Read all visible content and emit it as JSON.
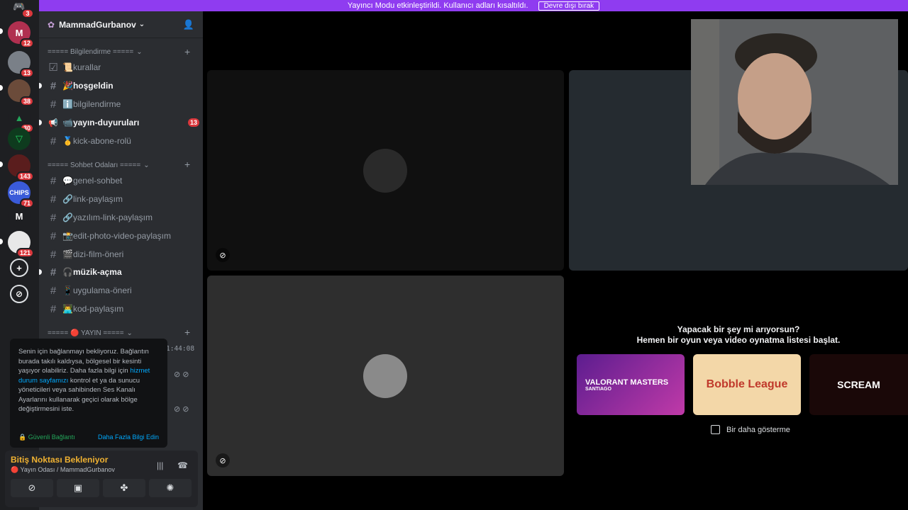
{
  "banner": {
    "text": "Yayıncı Modu etkinleştirildi. Kullanıcı adları kısaltıldı.",
    "button": "Devre dışı bırak"
  },
  "rail": {
    "servers": [
      {
        "name": "discord-home",
        "label": "",
        "badge": "3",
        "color": "#5865f2"
      },
      {
        "name": "server-m-red",
        "label": "M",
        "badge": "12",
        "color": "#b03050"
      },
      {
        "name": "server-2",
        "label": "",
        "badge": "13",
        "color": "#7a8088"
      },
      {
        "name": "server-3",
        "label": "",
        "badge": "38",
        "color": "#6b4b3a"
      },
      {
        "name": "server-4",
        "label": "",
        "badge": "30",
        "color": "#2f7d32"
      },
      {
        "name": "server-5",
        "label": "",
        "badge": "",
        "color": "#0e3b1e"
      },
      {
        "name": "server-6",
        "label": "",
        "badge": "143",
        "color": "#5a1d1d"
      },
      {
        "name": "server-7",
        "label": "",
        "badge": "71",
        "color": "#3a5bd9"
      },
      {
        "name": "server-m",
        "label": "M",
        "badge": "",
        "color": "#1e1f22"
      },
      {
        "name": "server-8",
        "label": "",
        "badge": "121",
        "color": "#e8e8e8"
      }
    ],
    "add_icon": "+",
    "discover_icon": "⊘"
  },
  "sidebar": {
    "server_name": "MammadGurbanov",
    "categories": [
      {
        "label": "===== Bilgilendirme ====="
      },
      {
        "label": "===== Sohbet Odaları ====="
      },
      {
        "label": "===== 🔴 YAYIN ====="
      }
    ],
    "channels": [
      {
        "icon": "☑",
        "label": "📜kurallar",
        "unread": false,
        "count": ""
      },
      {
        "icon": "#",
        "label": "🎉hoşgeldin",
        "unread": true,
        "count": ""
      },
      {
        "icon": "#",
        "label": "ℹ️bilgilendirme",
        "unread": false,
        "count": ""
      },
      {
        "icon": "📢",
        "label": "📹yayın-duyuruları",
        "unread": true,
        "count": "13"
      },
      {
        "icon": "#",
        "label": "🥇kick-abone-rolü",
        "unread": false,
        "count": ""
      },
      {
        "icon": "#",
        "label": "💬genel-sohbet",
        "unread": false,
        "count": ""
      },
      {
        "icon": "#",
        "label": "🔗link-paylaşım",
        "unread": false,
        "count": ""
      },
      {
        "icon": "#",
        "label": "🔗yazılım-link-paylaşım",
        "unread": false,
        "count": ""
      },
      {
        "icon": "#",
        "label": "📸edit-photo-video-paylaşım",
        "unread": false,
        "count": ""
      },
      {
        "icon": "#",
        "label": "🎬dizi-film-öneri",
        "unread": false,
        "count": ""
      },
      {
        "icon": "#",
        "label": "🎧müzik-açma",
        "unread": true,
        "count": ""
      },
      {
        "icon": "#",
        "label": "📱uygulama-öneri",
        "unread": false,
        "count": ""
      },
      {
        "icon": "#",
        "label": "👨‍💻kod-paylaşım",
        "unread": false,
        "count": ""
      }
    ],
    "timer": "1:44:08"
  },
  "popup": {
    "text1": "Senin için bağlanmayı bekliyoruz. Bağlantın burada takılı kaldıysa, bölgesel bir kesinti yaşıyor olabiliriz. Daha fazla bilgi için ",
    "link": "hizmet durum sayfamızı",
    "text2": " kontrol et ya da sunucu yöneticileri veya sahibinden Ses Kanalı Ayarlarını kullanarak geçici olarak bölge değiştirmesini iste.",
    "secure": "🔒 Güvenli Bağlantı",
    "learn_more": "Daha Fazla Bilgi Edin"
  },
  "voice": {
    "status": "Bitiş Noktası Bekleniyor",
    "channel": "🔴 Yayın Odası / MammadGurbanov"
  },
  "suggestion": {
    "line1": "Yapacak bir şey mi arıyorsun?",
    "line2": "Hemen bir oyun veya video oynatma listesi başlat.",
    "cards": [
      {
        "title": "VALORANT MASTERS",
        "subtitle": "SANTIAGO",
        "color": "#8a2bb8"
      },
      {
        "title": "Bobble League",
        "subtitle": "",
        "color": "#f3d7a8"
      },
      {
        "title": "SCREAM",
        "subtitle": "",
        "color": "#1a0808"
      }
    ],
    "dont_show": "Bir daha gösterme"
  }
}
